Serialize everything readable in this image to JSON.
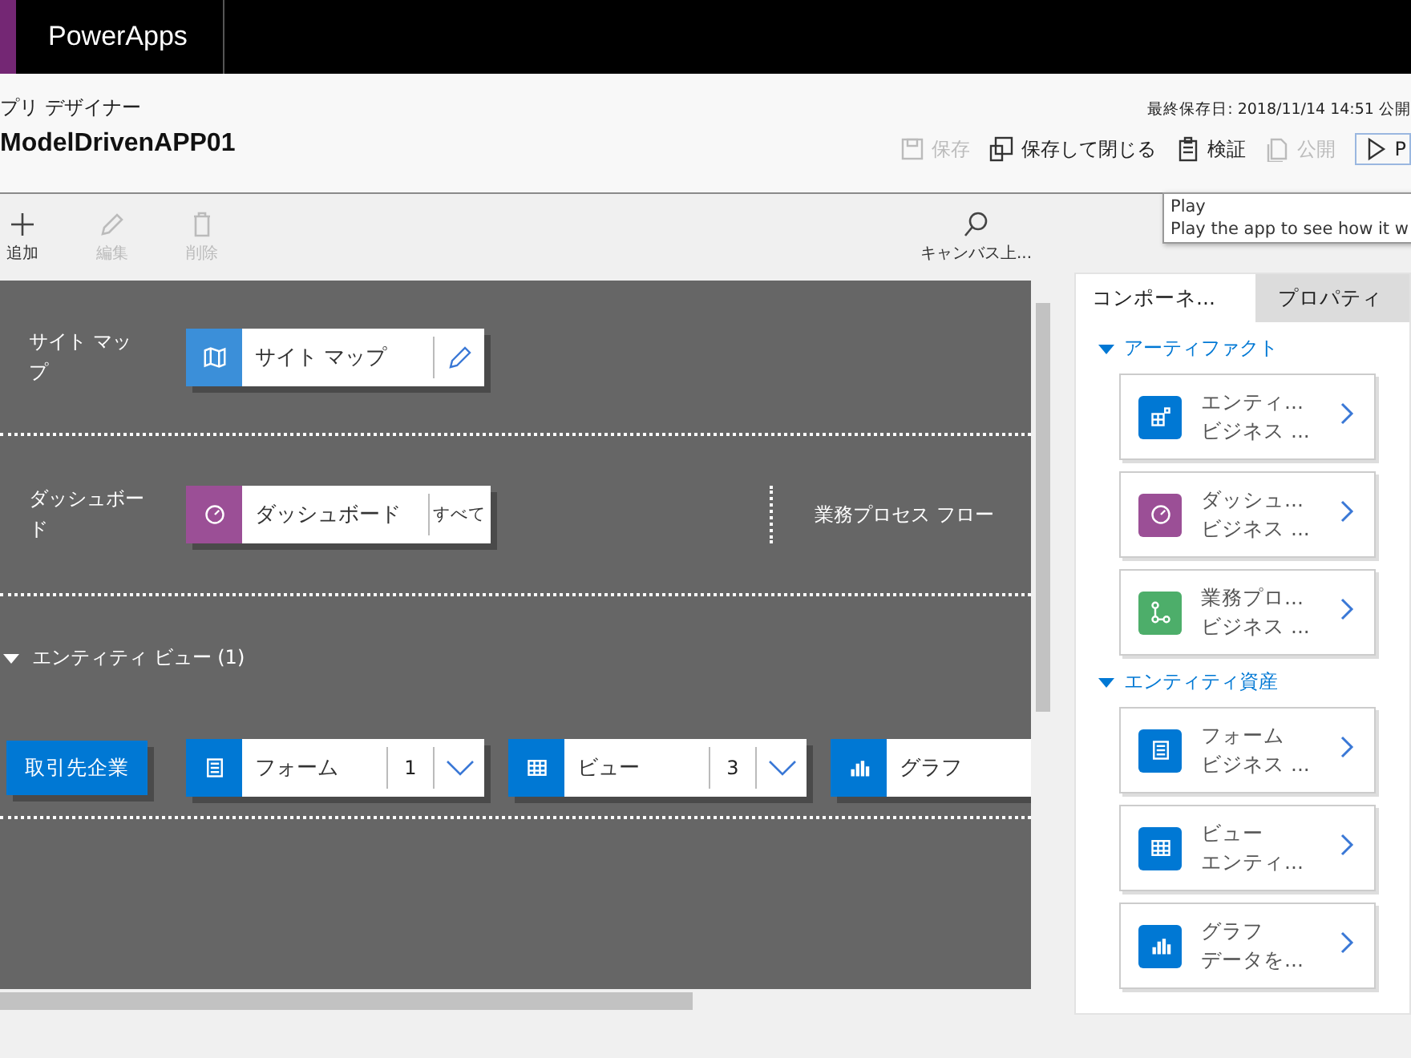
{
  "app_bar": {
    "title": "PowerApps"
  },
  "header": {
    "breadcrumb": "プリ デザイナー",
    "app_name": "ModelDrivenAPP01",
    "last_saved": "最終保存日: 2018/11/14 14:51 公開",
    "actions": [
      {
        "kind": "save",
        "label": "保存",
        "disabled": true
      },
      {
        "kind": "save-close",
        "label": "保存して閉じる",
        "disabled": false
      },
      {
        "kind": "validate",
        "label": "検証",
        "disabled": false
      },
      {
        "kind": "publish",
        "label": "公開",
        "disabled": true
      },
      {
        "kind": "play",
        "label": "P",
        "disabled": false
      }
    ]
  },
  "tooltip": {
    "title": "Play",
    "text": "Play the app to see how it w"
  },
  "toolbar": {
    "items": [
      {
        "kind": "add",
        "label": "追加",
        "disabled": false
      },
      {
        "kind": "edit",
        "label": "編集",
        "disabled": true
      },
      {
        "kind": "delete",
        "label": "削除",
        "disabled": true
      }
    ],
    "search": {
      "label": "キャンバス上..."
    }
  },
  "canvas": {
    "site_map": {
      "label": "サイト マップ",
      "tile": "サイト マップ"
    },
    "dashboard": {
      "label": "ダッシュボード",
      "tile": "ダッシュボード",
      "tile_extra": "すべて",
      "process_flow": "業務プロセス フロー"
    },
    "entity_view": {
      "heading": "エンティティ ビュー (1)",
      "expanded": true,
      "entity": "取引先企業",
      "assets": [
        {
          "kind": "form",
          "label": "フォーム",
          "count": "1"
        },
        {
          "kind": "view",
          "label": "ビュー",
          "count": "3"
        },
        {
          "kind": "chart",
          "label": "グラフ"
        }
      ]
    }
  },
  "panel": {
    "tabs": [
      {
        "label": "コンポーネ...",
        "selected": true
      },
      {
        "label": "プロパティ",
        "selected": false
      }
    ],
    "sections": [
      {
        "title": "アーティファクト",
        "expanded": true,
        "items": [
          {
            "kind": "entity",
            "title": "エンティ...",
            "subtitle": "ビジネス ..."
          },
          {
            "kind": "dashboard",
            "title": "ダッシュ...",
            "subtitle": "ビジネス ..."
          },
          {
            "kind": "process",
            "title": "業務プロ...",
            "subtitle": "ビジネス ..."
          }
        ]
      },
      {
        "title": "エンティティ資産",
        "expanded": true,
        "items": [
          {
            "kind": "form",
            "title": "フォーム",
            "subtitle": "ビジネス ..."
          },
          {
            "kind": "view",
            "title": "ビュー",
            "subtitle": "エンティ..."
          },
          {
            "kind": "chart",
            "title": "グラフ",
            "subtitle": "データを..."
          }
        ]
      }
    ]
  }
}
